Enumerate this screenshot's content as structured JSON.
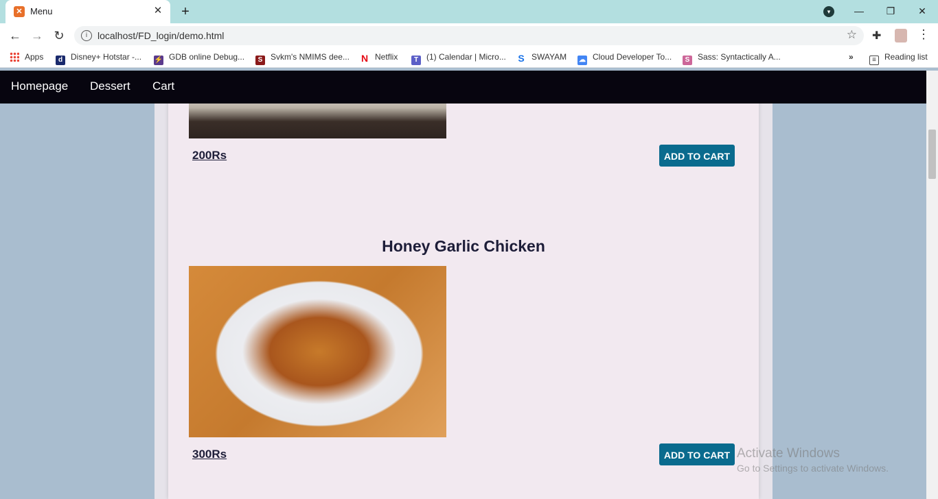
{
  "browser": {
    "tab_title": "Menu",
    "url": "localhost/FD_login/demo.html",
    "bookmarks": [
      {
        "label": "Apps",
        "icon": "apps-grid-icon",
        "color": "#ea4335"
      },
      {
        "label": "Disney+ Hotstar -...",
        "icon": "hotstar-icon",
        "color": "#1a2a6c"
      },
      {
        "label": "GDB online Debug...",
        "icon": "gdb-icon",
        "color": "#5b3a8c"
      },
      {
        "label": "Svkm's NMIMS dee...",
        "icon": "nmims-icon",
        "color": "#8b1a1a"
      },
      {
        "label": "Netflix",
        "icon": "netflix-icon",
        "color": "#e50914"
      },
      {
        "label": "(1) Calendar | Micro...",
        "icon": "teams-icon",
        "color": "#5b5fc7"
      },
      {
        "label": "SWAYAM",
        "icon": "swayam-icon",
        "color": "#1a73e8"
      },
      {
        "label": "Cloud Developer To...",
        "icon": "google-cloud-icon",
        "color": "#4285f4"
      },
      {
        "label": "Sass: Syntactically A...",
        "icon": "sass-icon",
        "color": "#cd6799"
      }
    ],
    "more_label": "»",
    "reading_list": "Reading list"
  },
  "nav": {
    "links": [
      "Homepage",
      "Dessert",
      "Cart"
    ]
  },
  "menu": {
    "items": [
      {
        "price": "200Rs",
        "button": "ADD TO CART"
      },
      {
        "name": "Honey Garlic Chicken",
        "price": "300Rs",
        "button": "ADD TO CART"
      }
    ]
  },
  "watermark": {
    "title": "Activate Windows",
    "subtitle": "Go to Settings to activate Windows."
  },
  "colors": {
    "navbar": "#07050f",
    "button": "#0a6b8e",
    "page_bg": "#a9bdcf",
    "card_bg": "#f2e9f0"
  }
}
